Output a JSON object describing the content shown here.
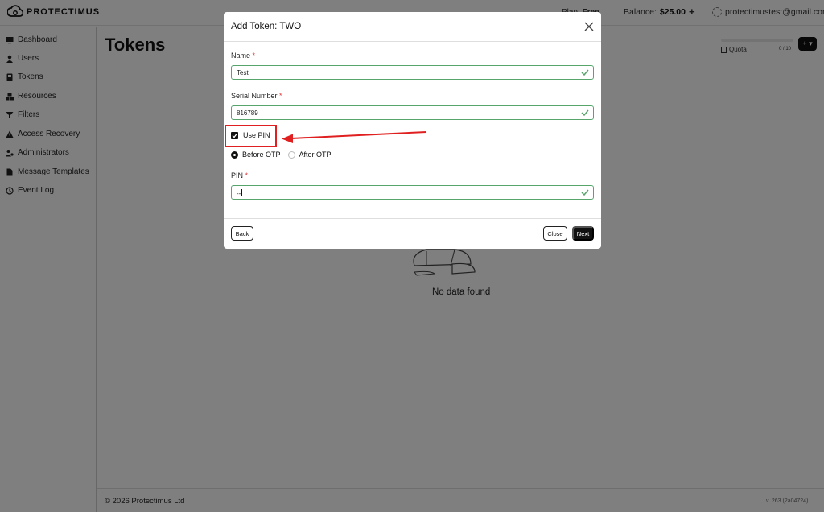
{
  "app": {
    "logo_text": "PROTECTIMUS",
    "plan_label": "Plan:",
    "plan_value": "Free",
    "balance_label": "Balance:",
    "balance_value": "$25.00",
    "balance_add": "+",
    "account_email": "protectimustest@gmail.com",
    "accent_color": "#111111",
    "valid_color": "#58a56c",
    "required_color": "#d9383a",
    "annotation_color": "#e02020"
  },
  "sidebar": {
    "items": [
      {
        "label": "Dashboard",
        "icon": "monitor-icon"
      },
      {
        "label": "Users",
        "icon": "user-icon"
      },
      {
        "label": "Tokens",
        "icon": "token-icon"
      },
      {
        "label": "Resources",
        "icon": "cubes-icon"
      },
      {
        "label": "Filters",
        "icon": "filter-icon"
      },
      {
        "label": "Access Recovery",
        "icon": "warning-icon"
      },
      {
        "label": "Administrators",
        "icon": "users-cog-icon"
      },
      {
        "label": "Message Templates",
        "icon": "file-icon"
      },
      {
        "label": "Event Log",
        "icon": "history-icon"
      }
    ]
  },
  "main": {
    "title": "Tokens",
    "quota_label": "Quota",
    "quota_count": "0 / 10",
    "add_button": "+ ▾",
    "empty_text": "No data found"
  },
  "footer": {
    "copyright": "© 2026 Protectimus Ltd",
    "version": "v. 263 (2a04724)"
  },
  "modal": {
    "title": "Add Token: TWO",
    "name_label": "Name",
    "name_value": "Test",
    "serial_label": "Serial Number",
    "serial_value": "816789",
    "use_pin_label": "Use PIN",
    "use_pin_checked": true,
    "pin_position_options": [
      "Before OTP",
      "After OTP"
    ],
    "pin_position_selected": "Before OTP",
    "pin_label": "PIN",
    "pin_value": "--",
    "required_mark": "*",
    "back_button": "Back",
    "close_button": "Close",
    "next_button": "Next"
  }
}
